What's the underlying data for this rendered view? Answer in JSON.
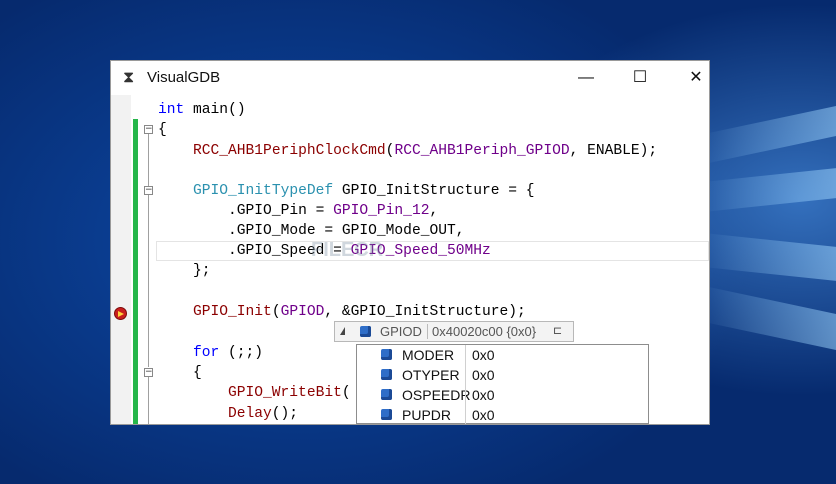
{
  "window": {
    "title": "VisualGDB",
    "app_icon": "hourglass-icon",
    "controls": {
      "minimize": "—",
      "maximize": "☐",
      "close": "✕"
    }
  },
  "code": {
    "l1_kw": "int",
    "l1_rest": " main()",
    "l2": "{",
    "l3_fn": "RCC_AHB1PeriphClockCmd",
    "l3_a": "(",
    "l3_mac": "RCC_AHB1Periph_GPIOD",
    "l3_b": ", ENABLE);",
    "l4_ty": "GPIO_InitTypeDef",
    "l4_rest": " GPIO_InitStructure = {",
    "l5_a": "    .GPIO_Pin = ",
    "l5_mac": "GPIO_Pin_12",
    "l5_b": ",",
    "l6": "    .GPIO_Mode = GPIO_Mode_OUT,",
    "l7_a": "    .GPIO_Speed = ",
    "l7_mac": "GPIO_Speed_50MHz",
    "l8": "};",
    "l9_fn": "GPIO_Init",
    "l9_a": "(",
    "l9_mac": "GPIOD",
    "l9_b": ", &GPIO_InitStructure);",
    "l10_kw": "for",
    "l10_rest": " (;;)",
    "l11": "{",
    "l12_fn": "GPIO_WriteBit",
    "l12_rest": "(",
    "l13_fn": "Delay",
    "l13_rest": "();"
  },
  "watermark": "FILECR",
  "datatip": {
    "variable": "GPIOD",
    "value": "0x40020c00 {0x0}",
    "members": [
      {
        "name": "MODER",
        "value": "0x0"
      },
      {
        "name": "OTYPER",
        "value": "0x0"
      },
      {
        "name": "OSPEEDR",
        "value": "0x0"
      },
      {
        "name": "PUPDR",
        "value": "0x0"
      }
    ]
  },
  "colors": {
    "keyword": "#0000ff",
    "type": "#2b91af",
    "macro": "#6f008a",
    "function": "#8b0000",
    "change_bar": "#26b64a",
    "breakpoint": "#c81e1e"
  }
}
